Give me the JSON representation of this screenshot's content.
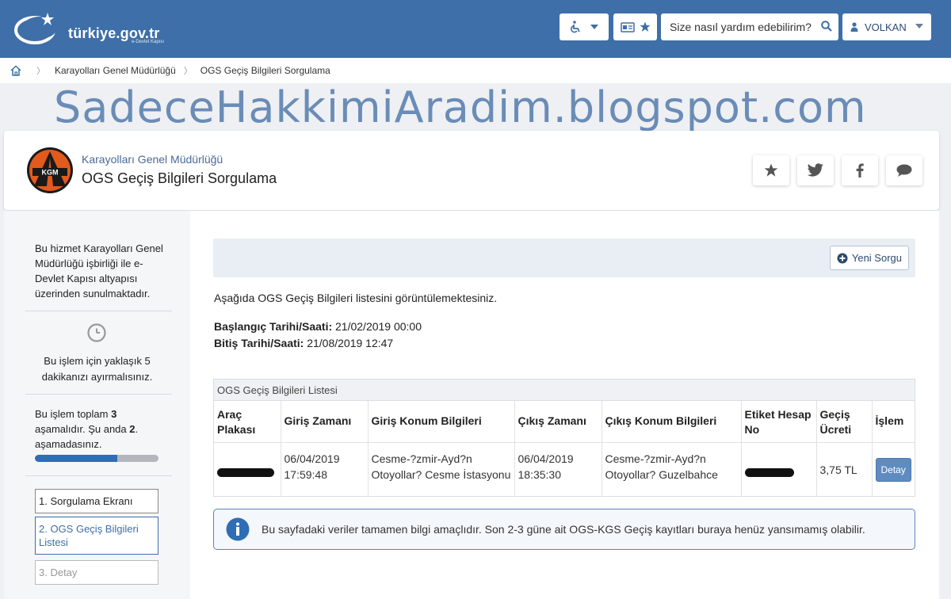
{
  "topbar": {
    "logo_text": "türkiye.gov.tr",
    "logo_subtext": "e-Devlet Kapısı",
    "search_placeholder": "Size nasıl yardım edebilirim?",
    "user_name": "VOLKAN",
    "accessibility_icon": "wheelchair-icon",
    "card_icon": "id-card-icon",
    "favorite_icon": "star-icon"
  },
  "breadcrumb": {
    "items": [
      "Karayolları Genel Müdürlüğü",
      "OGS Geçiş Bilgileri Sorgulama"
    ]
  },
  "watermark": "SadeceHakkimiAradim.blogspot.com",
  "header": {
    "org_name": "Karayolları Genel Müdürlüğü",
    "title": "OGS Geçiş Bilgileri Sorgulama",
    "logo_text": "KGM"
  },
  "sidebar": {
    "intro": "Bu hizmet Karayolları Genel Müdürlüğü işbirliği ile e-Devlet Kapısı altyapısı üzerinden sunulmaktadır.",
    "time_text": "Bu işlem için yaklaşık 5 dakikanızı ayırmalısınız.",
    "steps_text_a": "Bu işlem toplam ",
    "steps_total": "3",
    "steps_text_b": " aşamalıdır. Şu anda ",
    "steps_current": "2",
    "steps_text_c": ". aşamadasınız.",
    "progress_fraction": 0.667,
    "steps": [
      "1.    Sorgulama Ekranı",
      "2.    OGS Geçiş Bilgileri Listesi",
      "3.    Detay"
    ]
  },
  "main": {
    "new_query_label": "Yeni Sorgu",
    "info_text": "Aşağıda OGS Geçiş Bilgileri listesini görüntülemektesiniz.",
    "start_label": "Başlangıç Tarihi/Saati:",
    "start_value": " 21/02/2019 00:00",
    "end_label": "Bitiş Tarihi/Saati:",
    "end_value": " 21/08/2019 12:47",
    "table_title": "OGS Geçiş Bilgileri Listesi",
    "columns": [
      "Araç Plakası",
      "Giriş Zamanı",
      "Giriş Konum Bilgileri",
      "Çıkış Zamanı",
      "Çıkış Konum Bilgileri",
      "Etiket Hesap No",
      "Geçiş Ücreti",
      "İşlem"
    ],
    "row": {
      "entry_date": "06/04/2019",
      "entry_time": "17:59:48",
      "entry_location": "Cesme-?zmir-Ayd?n Otoyollar? Cesme İstasyonu",
      "exit_date": "06/04/2019",
      "exit_time": "18:35:30",
      "exit_location": "Cesme-?zmir-Ayd?n Otoyollar? Guzelbahce",
      "fee": "3,75 TL",
      "action": "Detay"
    },
    "notice": "Bu sayfadaki veriler tamamen bilgi amaçlıdır. Son 2-3 güne ait OGS-KGS Geçiş kayıtları buraya henüz yansımamış olabilir."
  },
  "colors": {
    "topbar": "#3e6fa8",
    "accent": "#2f6db5",
    "watermark": "#6a8cb7"
  }
}
